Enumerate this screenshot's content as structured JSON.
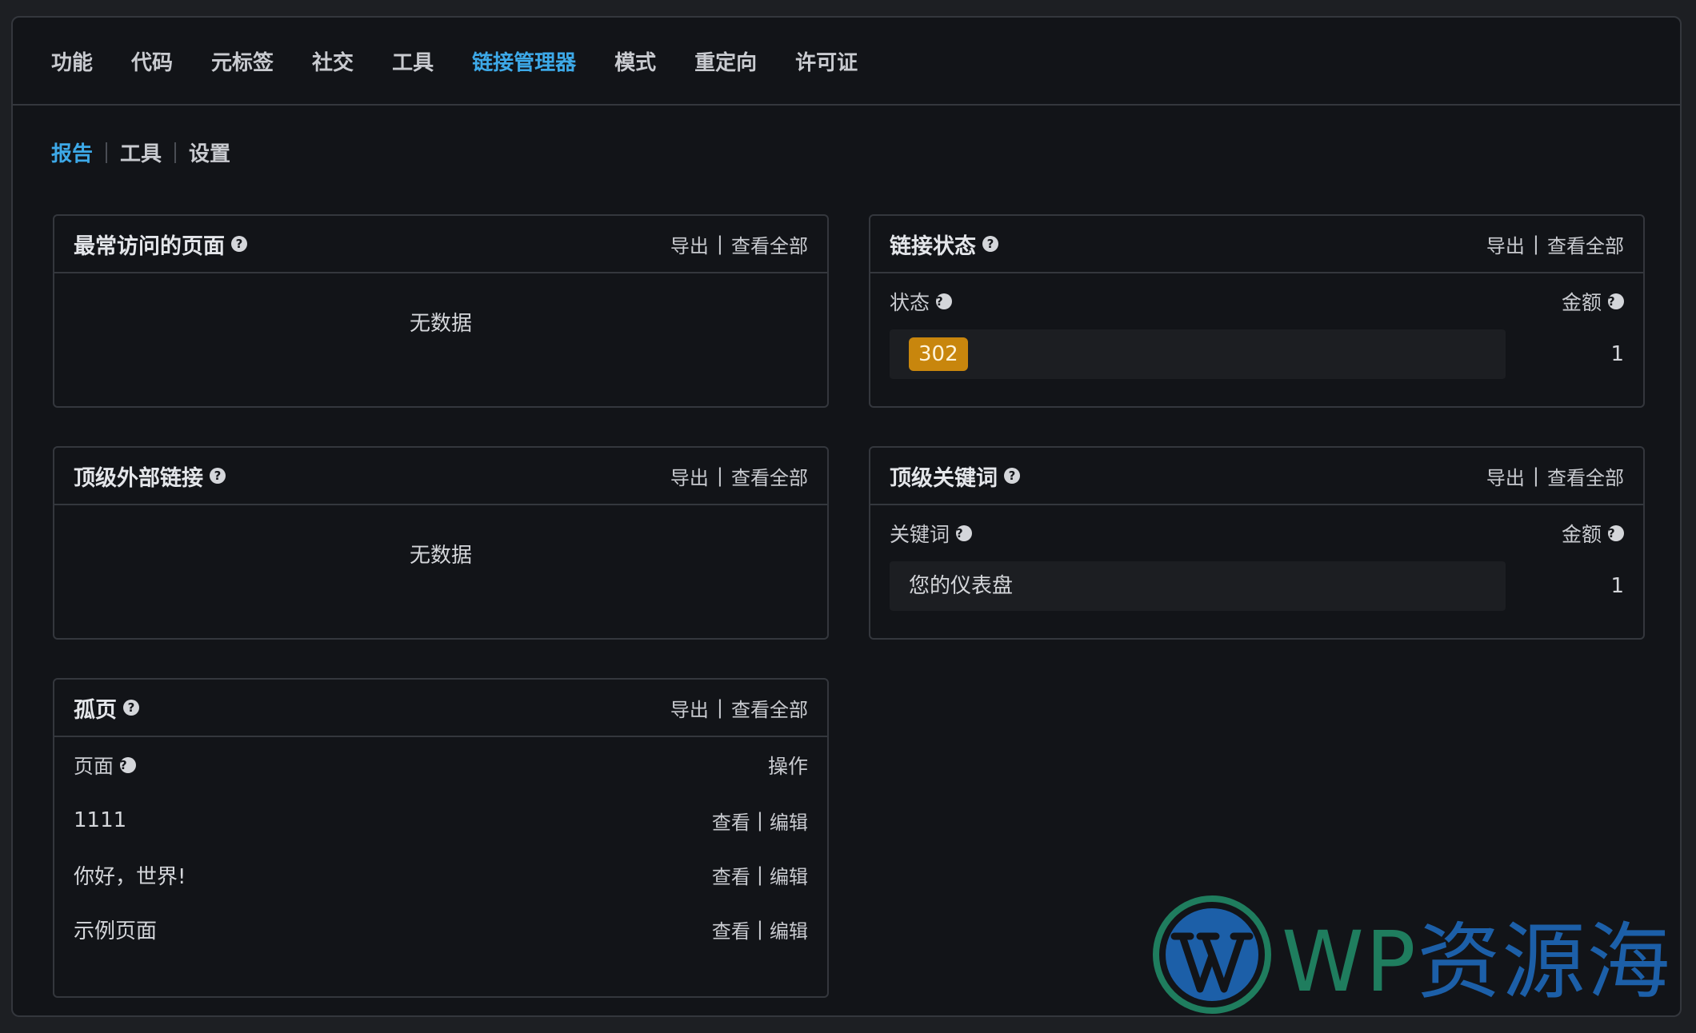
{
  "top_nav": {
    "items": [
      "功能",
      "代码",
      "元标签",
      "社交",
      "工具",
      "链接管理器",
      "模式",
      "重定向",
      "许可证"
    ],
    "active_index": 5
  },
  "sub_nav": {
    "items": [
      "报告",
      "工具",
      "设置"
    ],
    "active_index": 0
  },
  "common": {
    "export": "导出",
    "view_all": "查看全部",
    "separator": "|",
    "no_data": "无数据",
    "help_glyph": "?"
  },
  "cards": {
    "most_visited": {
      "title": "最常访问的页面"
    },
    "top_external": {
      "title": "顶级外部链接"
    },
    "orphan": {
      "title": "孤页",
      "col_page": "页面",
      "col_action": "操作",
      "action_view": "查看",
      "action_edit": "编辑",
      "rows": [
        "1111",
        "你好，世界!",
        "示例页面"
      ]
    },
    "link_status": {
      "title": "链接状态",
      "col_status": "状态",
      "col_amount": "金额",
      "row_badge": "302",
      "row_value": "1",
      "row_fill_fraction": 1.0
    },
    "top_keywords": {
      "title": "顶级关键词",
      "col_keyword": "关键词",
      "col_amount": "金额",
      "row_keyword": "您的仪表盘",
      "row_value": "1",
      "row_fill_fraction": 1.0
    }
  },
  "watermark": {
    "latin": "WP",
    "cjk": "资源海"
  },
  "colors": {
    "accent": "#3da9e8",
    "badge": "#c8860d",
    "wm_green": "#1f7d5e",
    "wm_blue": "#1c5fa8"
  }
}
